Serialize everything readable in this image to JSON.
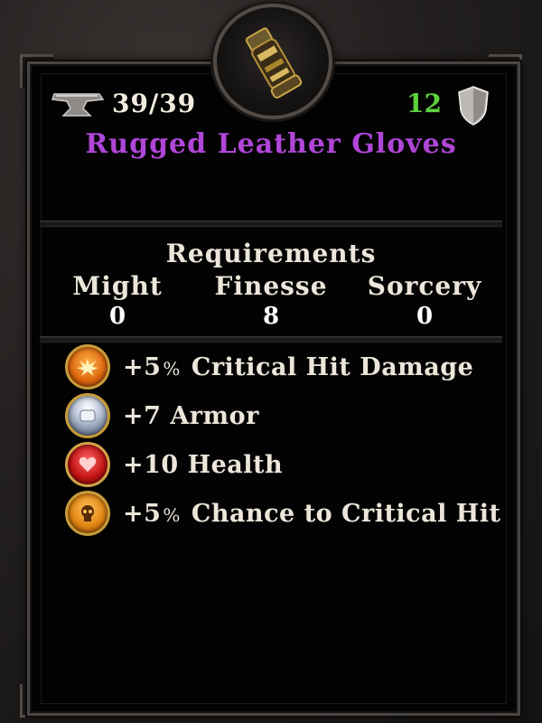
{
  "item": {
    "name": "Rugged Leather Gloves",
    "durability": "39/39",
    "armor_value": "12",
    "name_color": "#b046d8",
    "armor_color": "#5ed23d"
  },
  "requirements": {
    "title": "Requirements",
    "stats": [
      {
        "label": "Might",
        "value": "0"
      },
      {
        "label": "Finesse",
        "value": "8"
      },
      {
        "label": "Sorcery",
        "value": "0"
      }
    ]
  },
  "bonuses": [
    {
      "amount": "+5",
      "unit": "%",
      "label": "Critical Hit Damage",
      "icon": "critical-damage-orb-icon"
    },
    {
      "amount": "+7",
      "unit": "",
      "label": "Armor",
      "icon": "armor-orb-icon"
    },
    {
      "amount": "+10",
      "unit": "",
      "label": "Health",
      "icon": "health-orb-icon"
    },
    {
      "amount": "+5",
      "unit": "%",
      "label": "Chance to Critical Hit",
      "icon": "critical-chance-orb-icon"
    }
  ]
}
